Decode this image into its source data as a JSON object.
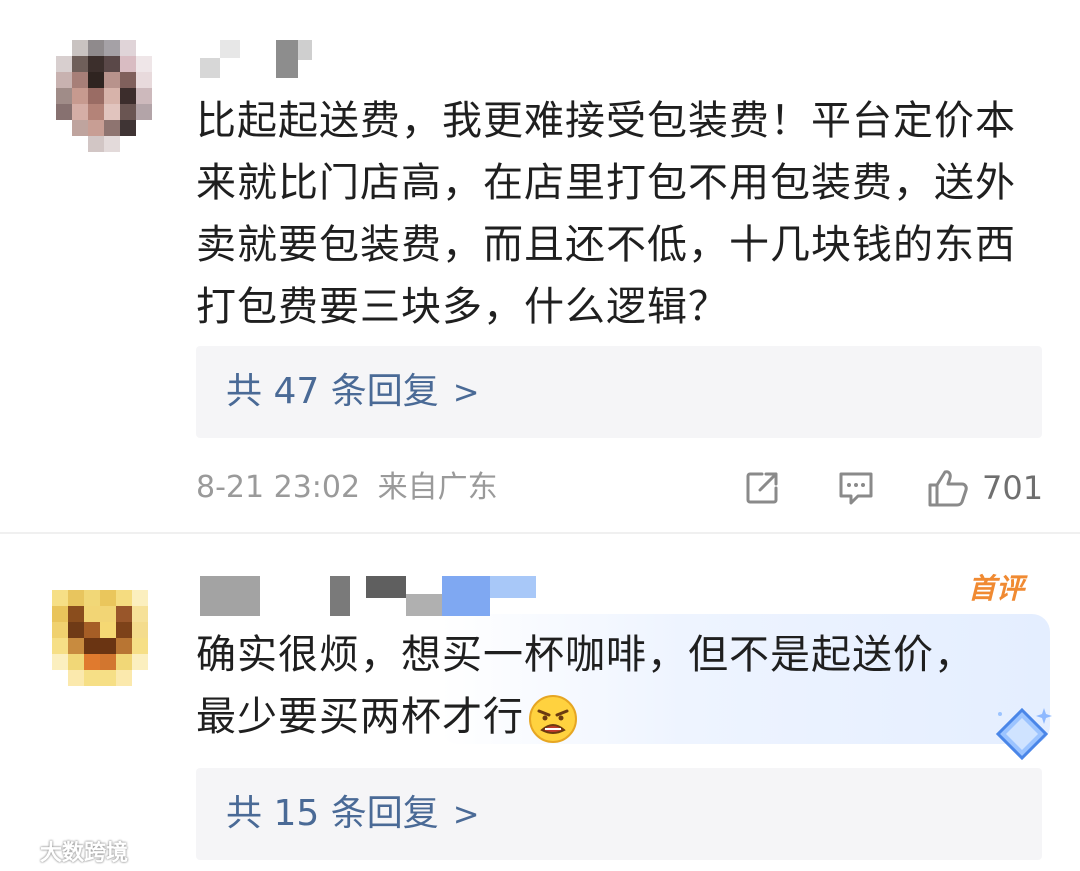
{
  "comments": [
    {
      "text": "比起起送费，我更难接受包装费！平台定价本来就比门店高，在店里打包不用包装费，送外卖就要包装费，而且还不低，十几块钱的东西打包费要三块多，什么逻辑？",
      "lines": [
        "比起起送费，我更难接受包装费！平台定价本",
        "来就比门店高，在店里打包不用包装费，送外",
        "卖就要包装费，而且还不低，十几块钱的东西",
        "打包费要三块多，什么逻辑？"
      ],
      "replies_label": "共 47 条回复",
      "chevron": ">",
      "timestamp": "8-21 23:02",
      "location": "来自广东",
      "share_icon": "share-icon",
      "comment_icon": "comment-icon",
      "like_icon": "thumbs-up-icon",
      "like_count": "701"
    },
    {
      "badge": "首评",
      "lines": [
        "确实很烦，想买一杯咖啡，但不是起送价，",
        "最少要买两杯才行"
      ],
      "emoji": "angry-face-emoji",
      "replies_label": "共 15 条回复",
      "chevron": ">"
    }
  ],
  "watermark": "大数跨境",
  "colors": {
    "reply_text": "#4a6a96",
    "reply_bg": "#f5f5f7",
    "meta_text": "#9a9a9a",
    "badge": "#f08a32",
    "highlight": "#e4eeff"
  }
}
